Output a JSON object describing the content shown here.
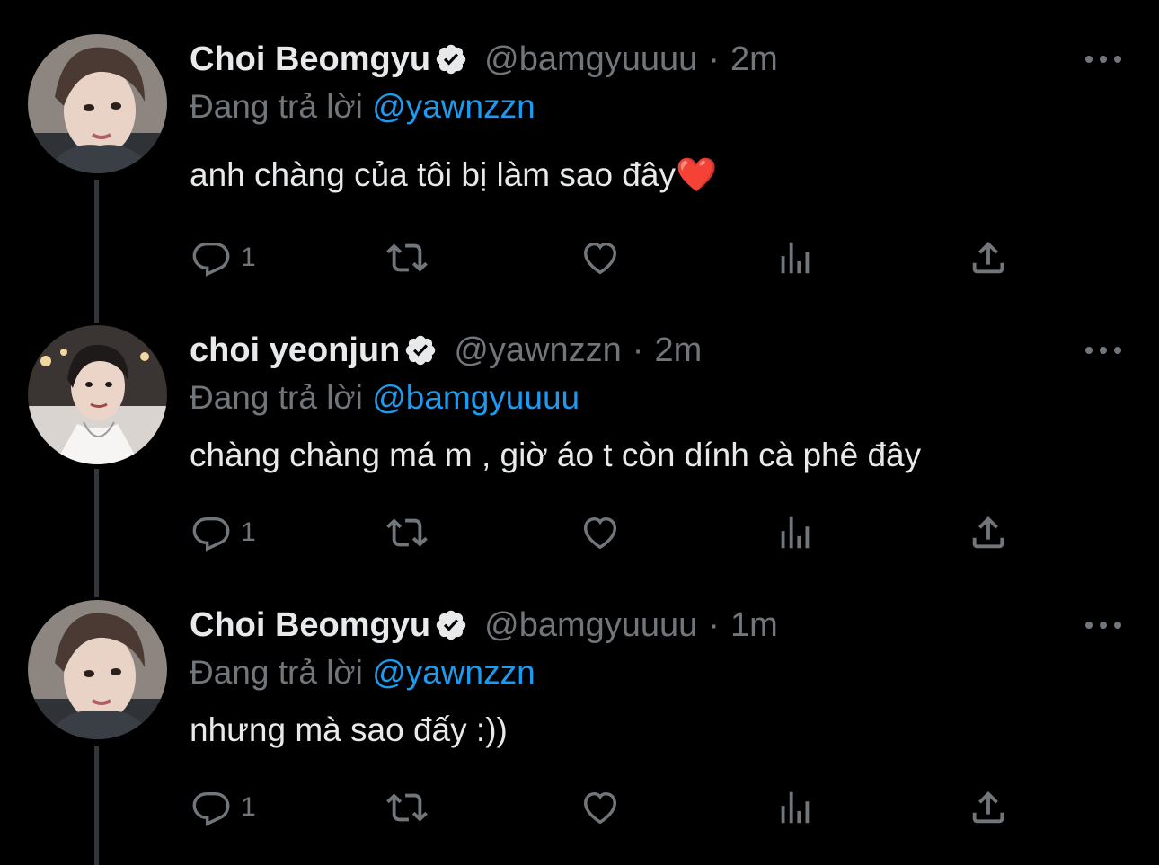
{
  "colors": {
    "background": "#000000",
    "text": "#e7e9ea",
    "secondary": "#71767b",
    "accent": "#1d9bf0",
    "thread_line": "#333639"
  },
  "tweets": [
    {
      "display_name": "Choi Beomgyu",
      "handle": "@bamgyuuuu",
      "separator": "·",
      "time": "2m",
      "reply_prefix": "Đang trả lời",
      "reply_to": "@yawnzzn",
      "text": "anh chàng của tôi bị làm sao đây❤️",
      "reply_count": "1",
      "avatar": "beomgyu-avatar"
    },
    {
      "display_name": "choi yeonjun",
      "handle": "@yawnzzn",
      "separator": "·",
      "time": "2m",
      "reply_prefix": "Đang trả lời",
      "reply_to": "@bamgyuuuu",
      "text": "chàng chàng má m , giờ áo t còn dính cà phê đây",
      "reply_count": "1",
      "avatar": "yeonjun-avatar"
    },
    {
      "display_name": "Choi Beomgyu",
      "handle": "@bamgyuuuu",
      "separator": "·",
      "time": "1m",
      "reply_prefix": "Đang trả lời",
      "reply_to": "@yawnzzn",
      "text": "nhưng mà sao đấy :))",
      "reply_count": "1",
      "avatar": "beomgyu-avatar"
    }
  ],
  "icons": {
    "reply": "reply-icon",
    "retweet": "retweet-icon",
    "like": "heart-icon",
    "views": "analytics-icon",
    "share": "share-icon",
    "more": "more-icon",
    "verified": "verified-badge-icon"
  }
}
